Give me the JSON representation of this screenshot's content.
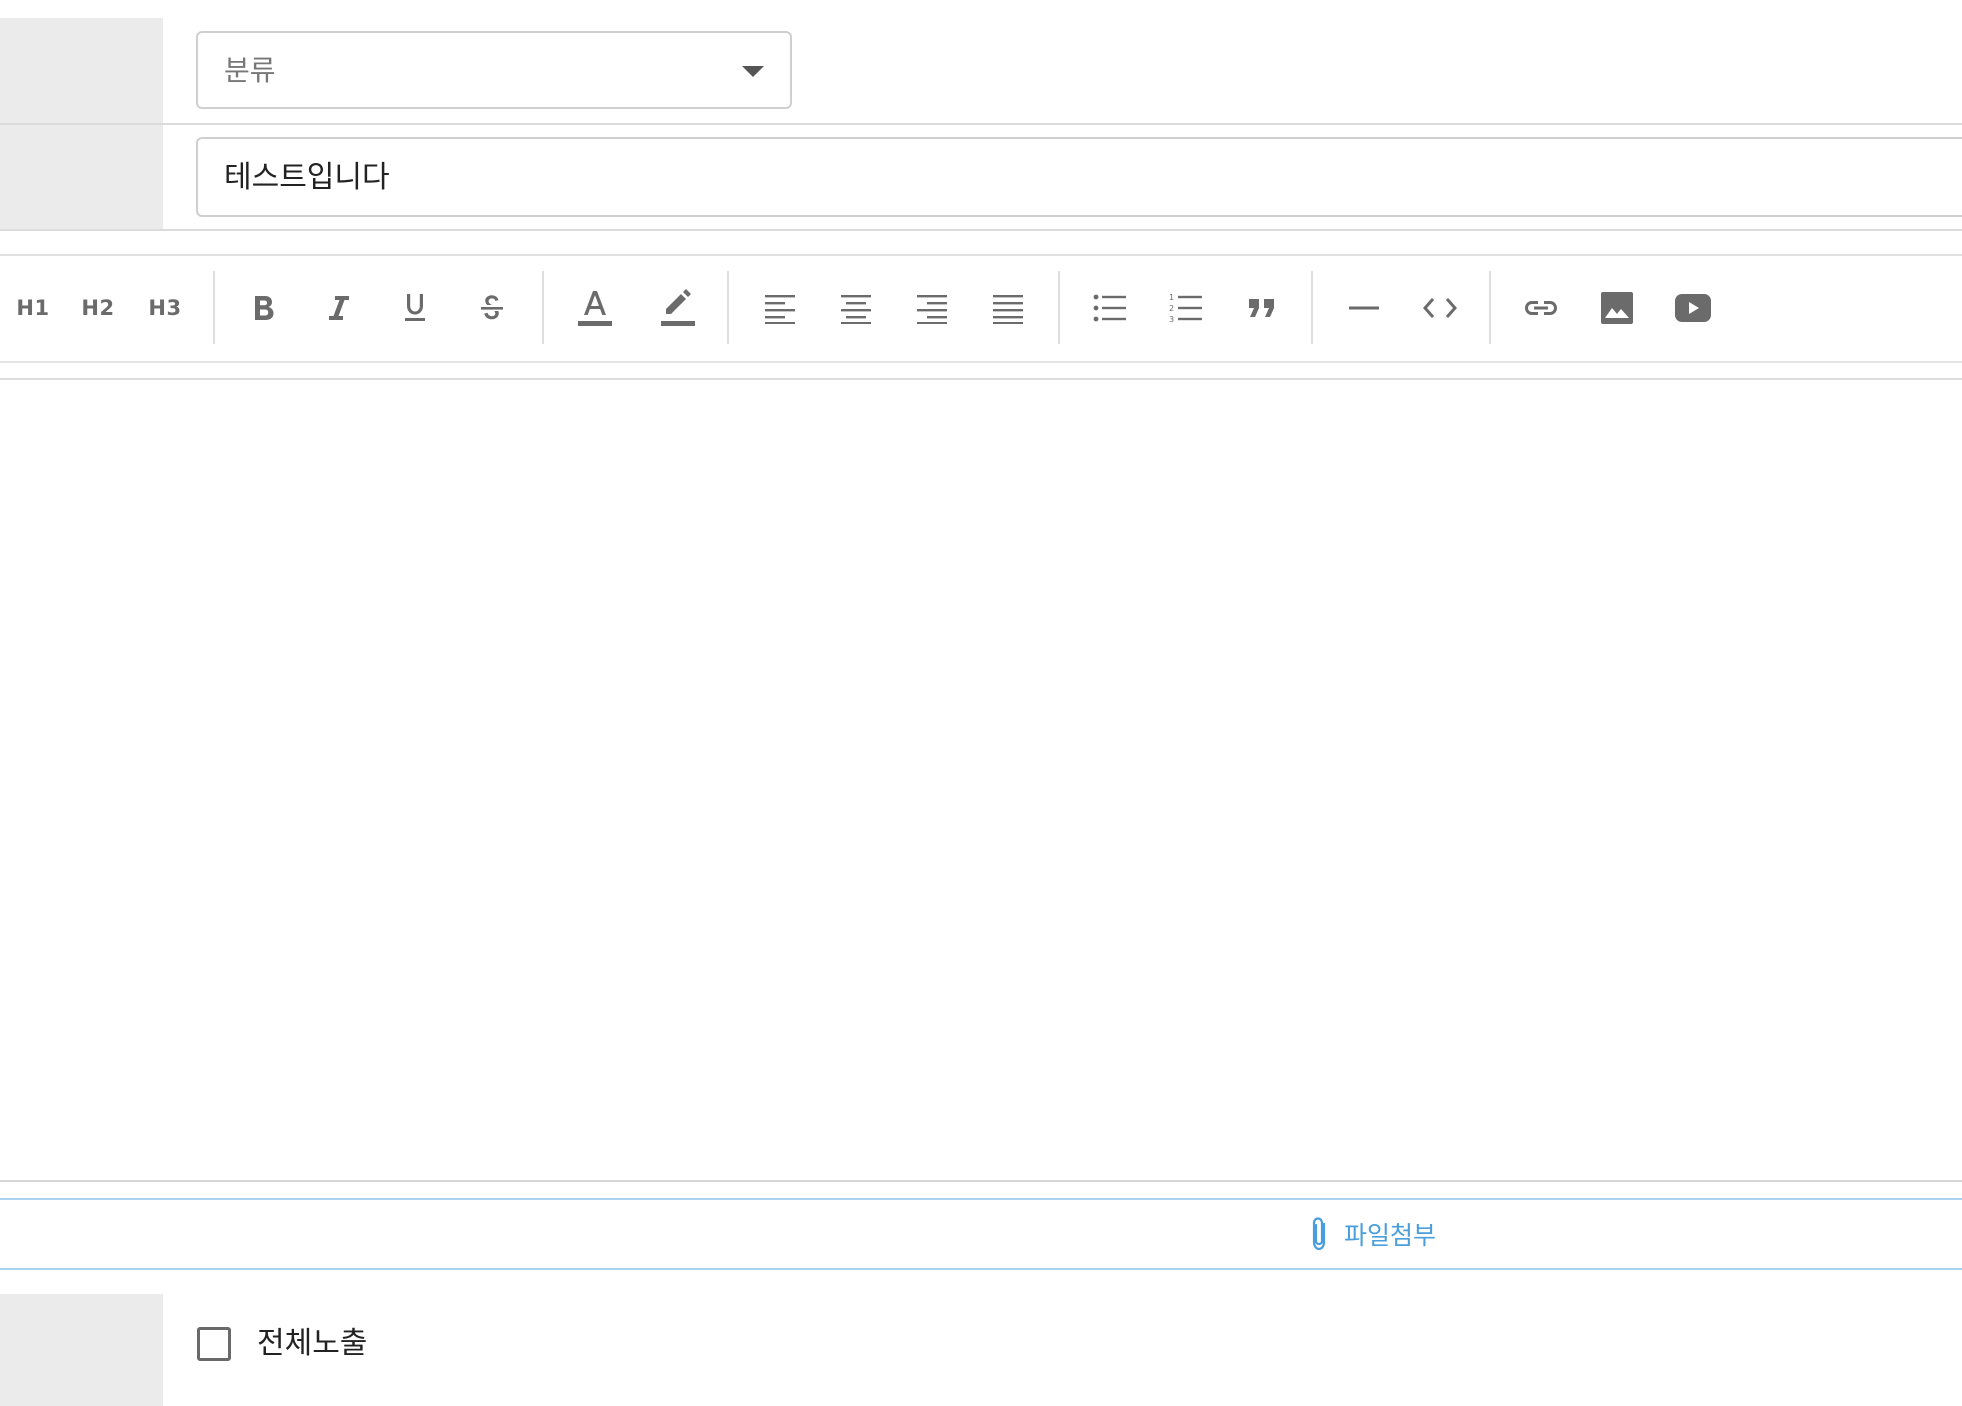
{
  "form": {
    "category_select": {
      "value": "분류"
    },
    "title_input": {
      "value": "테스트입니다"
    }
  },
  "toolbar": {
    "headings": [
      "H1",
      "H2",
      "H3"
    ],
    "icons": [
      "bold-icon",
      "italic-icon",
      "underline-icon",
      "strikethrough-icon",
      "text-color-icon",
      "highlight-icon",
      "align-left-icon",
      "align-center-icon",
      "align-right-icon",
      "align-justify-icon",
      "bullet-list-icon",
      "numbered-list-icon",
      "blockquote-icon",
      "horizontal-rule-icon",
      "code-icon",
      "link-icon",
      "image-icon",
      "video-icon"
    ]
  },
  "attach": {
    "label": "파일첨부",
    "icon": "paperclip-icon"
  },
  "visibility": {
    "label": "전체노출",
    "checked": false
  },
  "colors": {
    "label_bg": "#ebebeb",
    "border": "#cfcfcf",
    "icon": "#6b6b6b",
    "accent_blue": "#4a9edb",
    "text": "#222222"
  }
}
